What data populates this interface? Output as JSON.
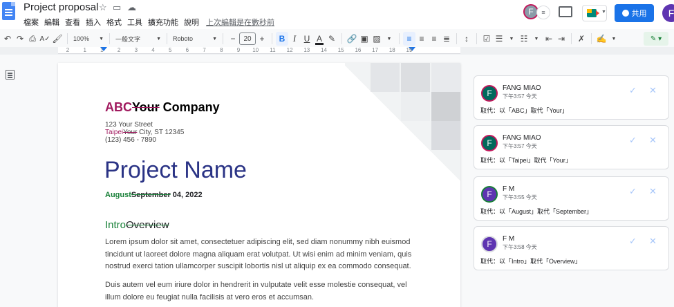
{
  "doc": {
    "title": "Project proposal",
    "menu": [
      "檔案",
      "編輯",
      "查看",
      "插入",
      "格式",
      "工具",
      "擴充功能",
      "說明"
    ],
    "last_edit": "上次編輯是在數秒前"
  },
  "header": {
    "share_label": "共用",
    "user_initial": "F",
    "viewer_initial": "F"
  },
  "toolbar": {
    "zoom": "100%",
    "style": "一般文字",
    "font": "Roboto",
    "font_size": "20"
  },
  "ruler": {
    "ticks": [
      "2",
      "1",
      "1",
      "2",
      "3",
      "4",
      "5",
      "6",
      "7",
      "8",
      "9",
      "10",
      "11",
      "12",
      "13",
      "14",
      "15",
      "16",
      "17",
      "18",
      "19"
    ]
  },
  "page": {
    "company_inserted": "ABC",
    "company_deleted": "Your",
    "company_rest": " Company",
    "address_line1": "123 Your Street",
    "address_inserted": "Taipei",
    "address_deleted": "Your",
    "address_rest": " City, ST 12345",
    "phone": "(123) 456 - 7890",
    "project_name": "Project Name",
    "date_inserted": "August",
    "date_deleted": "September",
    "date_rest": " 04, 2022",
    "heading_inserted": "Intro",
    "heading_deleted": "Overview",
    "para1": "Lorem ipsum dolor sit amet, consectetuer adipiscing elit, sed diam nonummy nibh euismod tincidunt ut laoreet dolore magna aliquam erat volutpat. Ut wisi enim ad minim veniam, quis nostrud exerci tation ullamcorper suscipit lobortis nisl ut aliquip ex ea commodo consequat.",
    "para2": "Duis autem vel eum iriure dolor in hendrerit in vulputate velit esse molestie consequat, vel illum dolore eu feugiat nulla facilisis at vero eros et accumsan."
  },
  "comments": [
    {
      "initial": "F",
      "name": "FANG MIAO",
      "time": "下午3:57 今天",
      "text": "取代：以「ABC」取代「Your」",
      "color": "#00695c",
      "ring": "#c2185b"
    },
    {
      "initial": "F",
      "name": "FANG MIAO",
      "time": "下午3:57 今天",
      "text": "取代：以「Taipei」取代「Your」",
      "color": "#00695c",
      "ring": "#c2185b"
    },
    {
      "initial": "F",
      "name": "F M",
      "time": "下午3:55 今天",
      "text": "取代：以「August」取代「September」",
      "color": "#5e35b1",
      "ring": "#188038"
    },
    {
      "initial": "F",
      "name": "F M",
      "time": "下午3:58 今天",
      "text": "取代：以「Intro」取代「Overview」",
      "color": "#5e35b1",
      "ring": "#dadce0"
    }
  ],
  "colors": {
    "accent": "#1a73e8",
    "suggest_pink": "#a0195e",
    "suggest_green": "#188038",
    "title_navy": "#2a3385"
  }
}
